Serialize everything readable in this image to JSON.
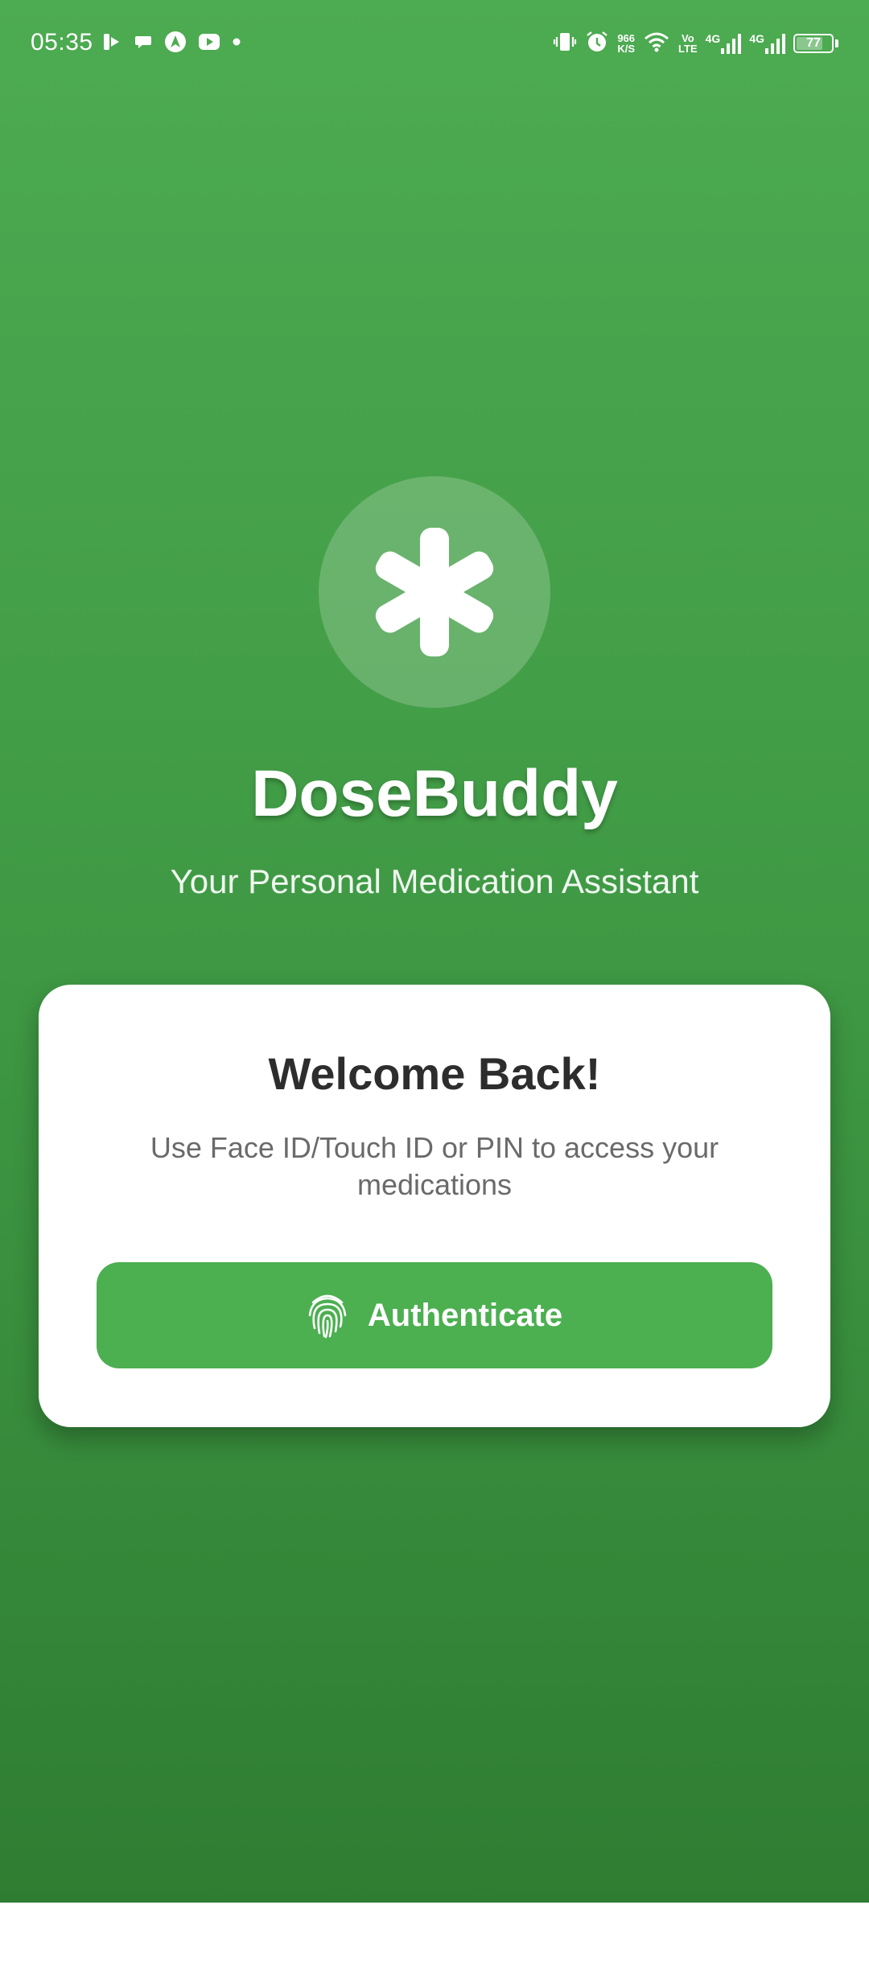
{
  "status_bar": {
    "time": "05:35",
    "net_speed_value": "966",
    "net_speed_unit": "K/S",
    "volte_top": "Vo",
    "volte_bottom": "LTE",
    "sim1_label": "4G",
    "sim2_label": "4G",
    "battery": "77",
    "battery_level": 0.77
  },
  "app": {
    "title": "DoseBuddy",
    "subtitle": "Your Personal Medication Assistant"
  },
  "card": {
    "title": "Welcome Back!",
    "description": "Use Face ID/Touch ID or PIN to access your medications",
    "button_label": "Authenticate"
  },
  "colors": {
    "background_top": "#4dab51",
    "background_bottom": "#2f7d32",
    "button": "#4caf50",
    "card": "#ffffff",
    "title_text": "#2d2d2d",
    "body_text": "#6a6a6a"
  },
  "icons": {
    "logo": "medical-asterisk-icon",
    "button": "fingerprint-icon"
  }
}
